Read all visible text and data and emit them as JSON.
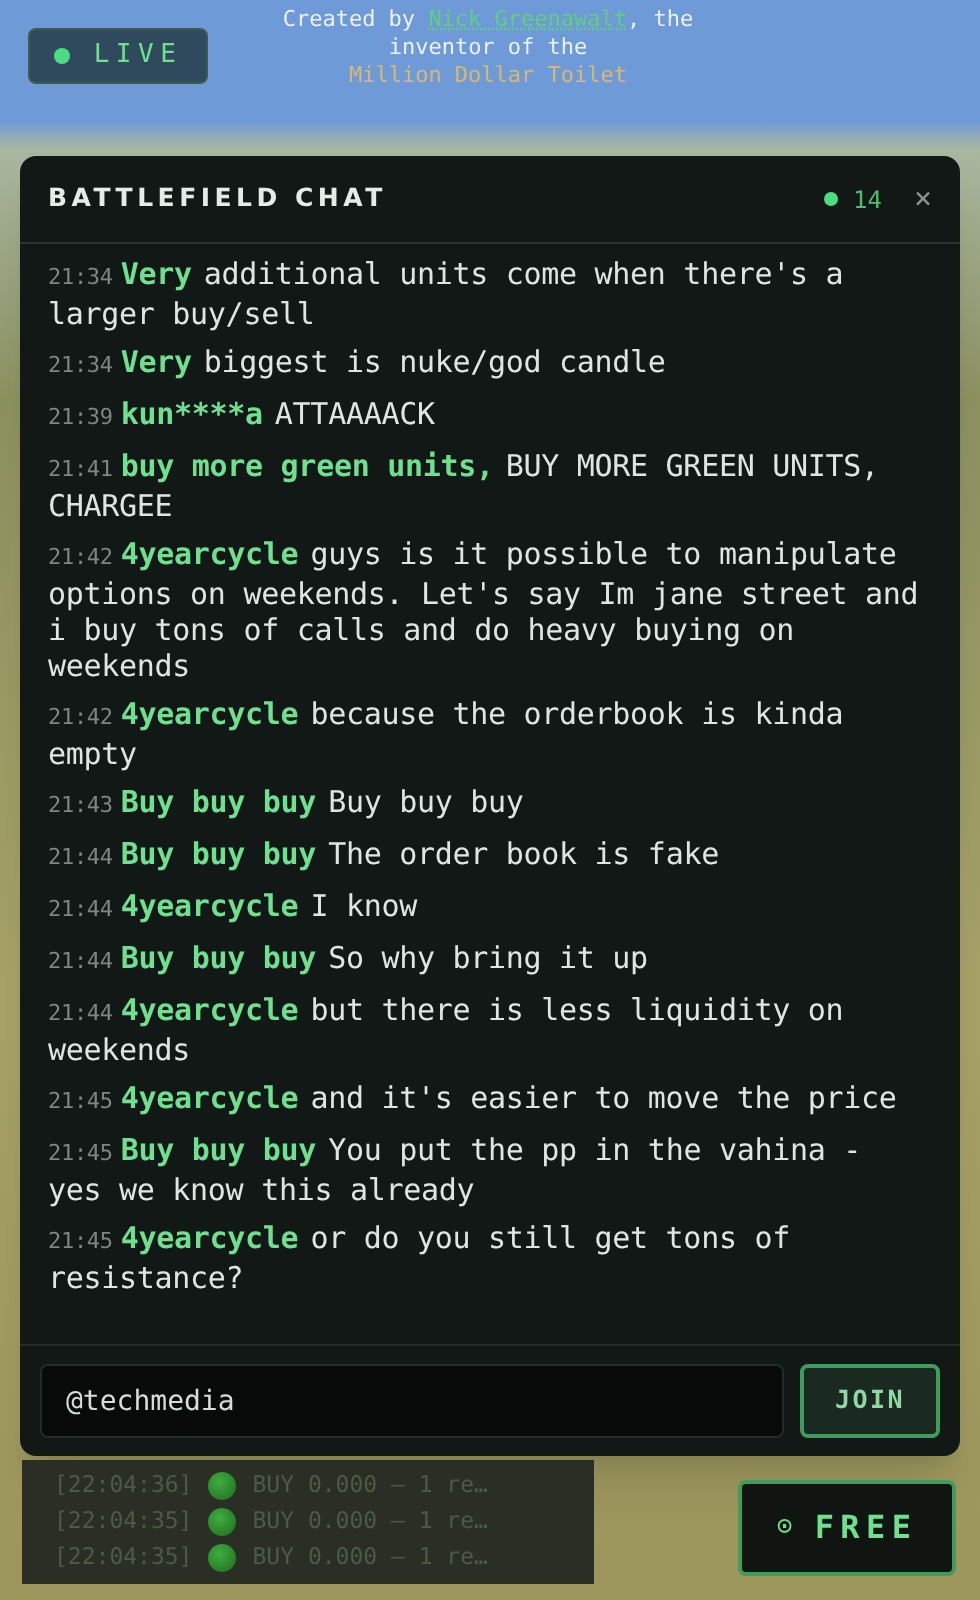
{
  "live_badge": {
    "label": "LIVE"
  },
  "credit": {
    "prefix": "Created by ",
    "author": "Nick Greenawalt",
    "middle": ", the inventor of the ",
    "product": "Million Dollar Toilet"
  },
  "chat": {
    "title": "BATTLEFIELD CHAT",
    "online_count": "14",
    "close": "×",
    "messages": [
      {
        "time": "21:34",
        "user": "Very",
        "text": "additional units come when there's a larger buy/sell"
      },
      {
        "time": "21:34",
        "user": "Very",
        "text": "biggest is nuke/god candle"
      },
      {
        "time": "21:39",
        "user": "kun****a",
        "text": "ATTAAAACK"
      },
      {
        "time": "21:41",
        "user": "buy more green units,",
        "text": "BUY MORE GREEN UNITS, CHARGEE"
      },
      {
        "time": "21:42",
        "user": "4yearcycle",
        "text": "guys is it possible to manipulate options on weekends. Let's say Im jane street and i buy tons of calls and do heavy buying on weekends"
      },
      {
        "time": "21:42",
        "user": "4yearcycle",
        "text": "because the orderbook is kinda empty"
      },
      {
        "time": "21:43",
        "user": "Buy buy buy",
        "text": "Buy buy buy"
      },
      {
        "time": "21:44",
        "user": "Buy buy buy",
        "text": "The order book is fake"
      },
      {
        "time": "21:44",
        "user": "4yearcycle",
        "text": "I know"
      },
      {
        "time": "21:44",
        "user": "Buy buy buy",
        "text": "So why bring it up"
      },
      {
        "time": "21:44",
        "user": "4yearcycle",
        "text": "but there is less liquidity on weekends"
      },
      {
        "time": "21:45",
        "user": "4yearcycle",
        "text": "and it's easier to move the price"
      },
      {
        "time": "21:45",
        "user": "Buy buy buy",
        "text": "You put the pp in the vahina - yes we know this already"
      },
      {
        "time": "21:45",
        "user": "4yearcycle",
        "text": "or do you still get tons of resistance?"
      }
    ],
    "input": {
      "value": "@techmedia"
    },
    "join_button": "JOIN"
  },
  "trade_log": [
    {
      "time": "[22:04:36]",
      "text": "BUY 0.000 — 1 re…"
    },
    {
      "time": "[22:04:35]",
      "text": "BUY 0.000 — 1 re…"
    },
    {
      "time": "[22:04:35]",
      "text": "BUY 0.000 — 1 re…"
    }
  ],
  "free_button": {
    "icon": "⊙",
    "label": "FREE"
  }
}
